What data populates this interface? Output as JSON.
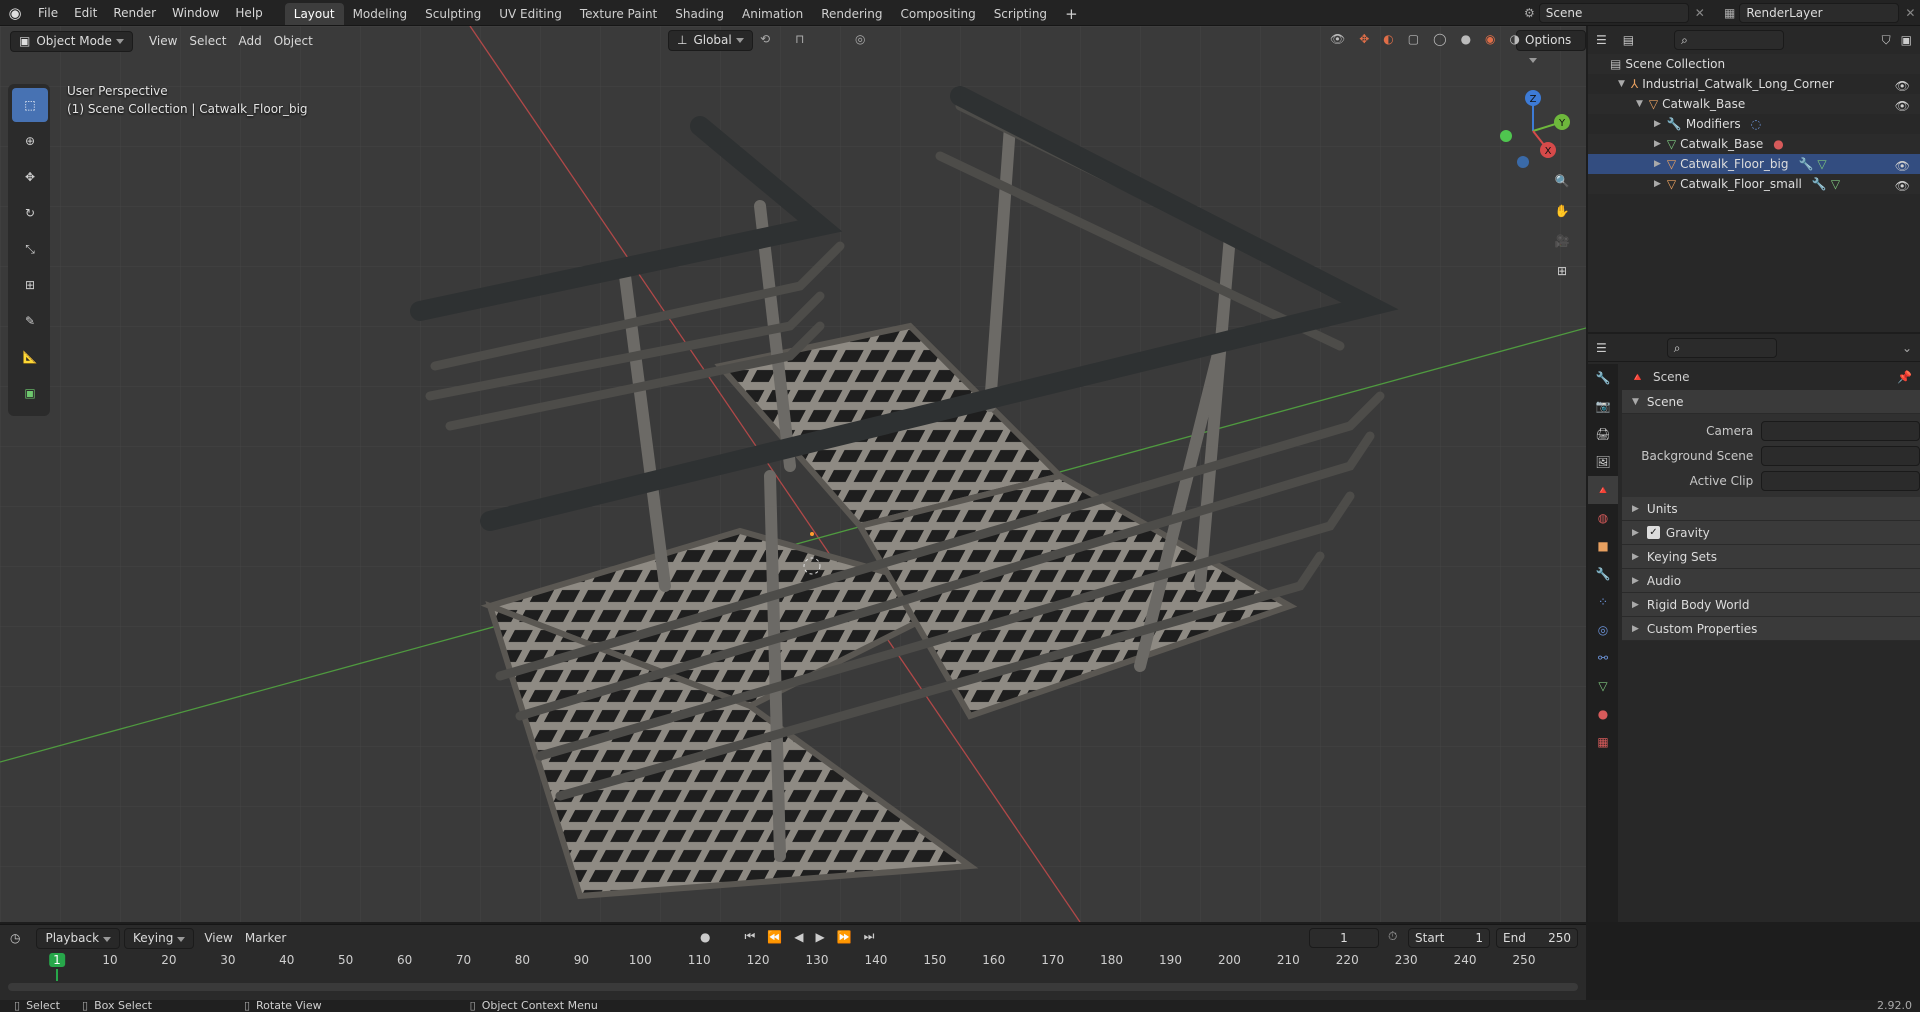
{
  "menu": {
    "items": [
      "File",
      "Edit",
      "Render",
      "Window",
      "Help"
    ]
  },
  "workspaces": [
    "Layout",
    "Modeling",
    "Sculpting",
    "UV Editing",
    "Texture Paint",
    "Shading",
    "Animation",
    "Rendering",
    "Compositing",
    "Scripting"
  ],
  "scene_field": "Scene",
  "renderlayer_field": "RenderLayer",
  "viewport": {
    "mode": "Object Mode",
    "menus": [
      "View",
      "Select",
      "Add",
      "Object"
    ],
    "transform_orientation": "Global",
    "options": "Options",
    "perspective": "User Perspective",
    "context": "(1) Scene Collection | Catwalk_Floor_big",
    "gizmo": {
      "x": "X",
      "y": "Y",
      "z": "Z"
    }
  },
  "outliner": {
    "root": "Scene Collection",
    "items": [
      {
        "label": "Industrial_Catwalk_Long_Corner",
        "indent": 1
      },
      {
        "label": "Catwalk_Base",
        "indent": 2
      },
      {
        "label": "Modifiers",
        "indent": 3
      },
      {
        "label": "Catwalk_Base",
        "indent": 3
      },
      {
        "label": "Catwalk_Floor_big",
        "indent": 3
      },
      {
        "label": "Catwalk_Floor_small",
        "indent": 3
      }
    ]
  },
  "properties": {
    "header": "Scene",
    "panel": "Scene",
    "fields": [
      "Camera",
      "Background Scene",
      "Active Clip"
    ],
    "subpanels": [
      "Units",
      "Gravity",
      "Keying Sets",
      "Audio",
      "Rigid Body World",
      "Custom Properties"
    ]
  },
  "timeline": {
    "menus": [
      "Playback",
      "Keying",
      "View",
      "Marker"
    ],
    "current_frame": "1",
    "start_label": "Start",
    "start_value": "1",
    "end_label": "End",
    "end_value": "250",
    "ticks": [
      "1",
      "10",
      "20",
      "30",
      "40",
      "50",
      "60",
      "70",
      "80",
      "90",
      "100",
      "110",
      "120",
      "130",
      "140",
      "150",
      "160",
      "170",
      "180",
      "190",
      "200",
      "210",
      "220",
      "230",
      "240",
      "250"
    ]
  },
  "statusbar": {
    "select": "Select",
    "box_select": "Box Select",
    "rotate_view": "Rotate View",
    "context_menu": "Object Context Menu",
    "version": "2.92.0"
  },
  "colors": {
    "accent": "#4772b3",
    "active_frame": "#27a74a",
    "selection": "#334d80"
  }
}
